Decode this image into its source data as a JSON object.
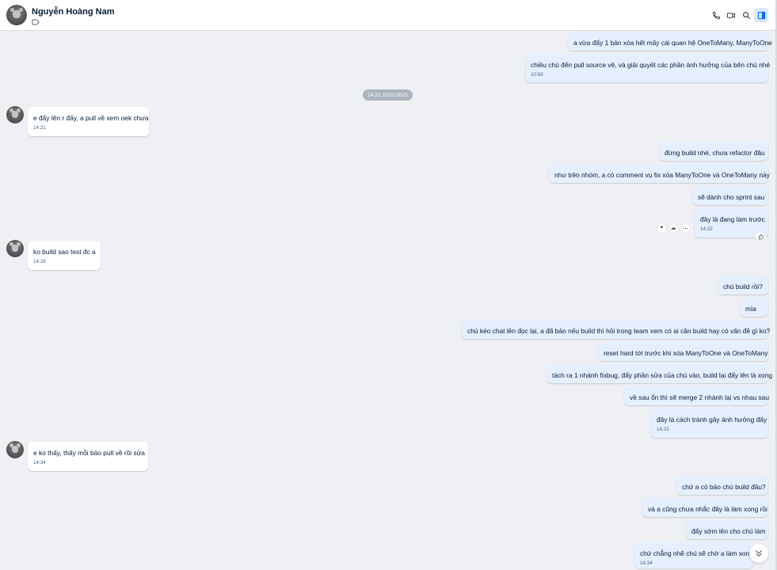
{
  "header": {
    "name": "Nguyễn Hoàng Nam",
    "icons": [
      "phone-icon",
      "video-call-icon",
      "search-icon",
      "sidebar-toggle-icon"
    ]
  },
  "date_separator": "14:21 10/11/2025",
  "messages": [
    {
      "from": "me",
      "text": "a vừa đẩy 1 bản xóa hết mấy cái quan hệ OneToMany, ManyToOne",
      "time": ""
    },
    {
      "from": "me",
      "text": "chiều chú đến pull source về, và giải quyết các phần ảnh hưởng của bên chú nhé",
      "time": "10:58"
    },
    {
      "from": "them",
      "text": "e đẩy lên r đấy, a pull về xem oek chưa",
      "time": "14:21"
    },
    {
      "from": "me",
      "text": "đừng build nhé, chưa refactor đâu",
      "time": ""
    },
    {
      "from": "me",
      "text": "như trên nhóm, a có comment vụ fix xóa ManyToOne và OneToMany này",
      "time": ""
    },
    {
      "from": "me",
      "text": "sẽ dành cho sprint sau",
      "time": ""
    },
    {
      "from": "me",
      "text": "đây là đang làm trước",
      "time": "14:22"
    },
    {
      "from": "them",
      "text": "ko build sao test đc a",
      "time": "14:28"
    },
    {
      "from": "me",
      "text": "chú build rồi?",
      "time": ""
    },
    {
      "from": "me",
      "text": "mìa",
      "time": ""
    },
    {
      "from": "me",
      "text": "chú kéo chat lên đọc lại, a đã bảo nếu build thì hỏi trong team xem có ai cần build hay có vấn đề gì ko?",
      "time": ""
    },
    {
      "from": "me",
      "text": "reset hard tới trước khi xóa ManyToOne và OneToMany",
      "time": ""
    },
    {
      "from": "me",
      "text": "tách ra 1 nhánh fixbug, đẩy phần sửa của chú vào, build lại đẩy lên là xong",
      "time": ""
    },
    {
      "from": "me",
      "text": "về sau ổn thì sẽ merge 2 nhánh lại vs nhau sau",
      "time": ""
    },
    {
      "from": "me",
      "text": "đây là cách tránh gây ảnh hưởng đấy",
      "time": "14:32"
    },
    {
      "from": "them",
      "text": "e ko thấy, thấy mỗi bảo pull về rồi sửa",
      "time": "14:34"
    },
    {
      "from": "me",
      "text": "chứ a có bảo chú build đâu?",
      "time": ""
    },
    {
      "from": "me",
      "text": "và a cũng chưa nhắc đây là làm xong rồi",
      "time": ""
    },
    {
      "from": "me",
      "text": "đẩy sớm lên cho chú làm",
      "time": ""
    },
    {
      "from": "me",
      "text": "chứ chẳng nhẽ chú sẽ chờ a làm xong h",
      "time": "14:34"
    }
  ],
  "hover_actions": [
    "quote-icon",
    "forward-icon",
    "more-icon"
  ],
  "colors": {
    "my_bubble": "#e5efff",
    "their_bubble": "#ffffff",
    "background": "#eef0f3",
    "accent": "#0068ff"
  }
}
